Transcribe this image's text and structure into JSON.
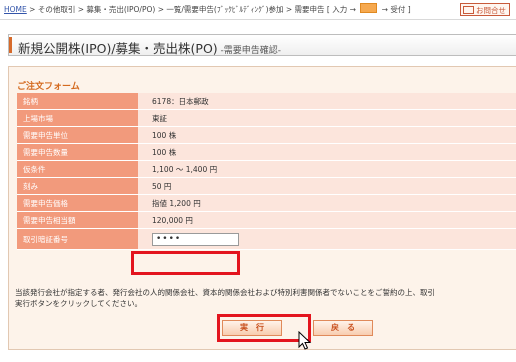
{
  "breadcrumb": {
    "home": "HOME",
    "path": " > その他取引 > 募集・売出(IPO/PO) > 一覧/需要申告(ﾌﾞｯｸﾋﾞﾙﾃﾞｨﾝｸﾞ)参加 > 需要申告 [ 入力 → ",
    "end": " → 受付 ]"
  },
  "contact": "お問合せ",
  "page_title": "新規公開株(IPO)/募集・売出株(PO)",
  "page_subtitle": " -需要申告確認-",
  "form": {
    "heading": "ご注文フォーム",
    "rows": [
      {
        "label": "銘柄",
        "value": "6178：日本郵政"
      },
      {
        "label": "上場市場",
        "value": "東証"
      },
      {
        "label": "需要申告単位",
        "value": "100 株"
      },
      {
        "label": "需要申告数量",
        "value": "100 株"
      },
      {
        "label": "仮条件",
        "value": "1,100 ～ 1,400 円"
      },
      {
        "label": "刻み",
        "value": "50 円"
      },
      {
        "label": "需要申告価格",
        "value": "指値 1,200 円"
      },
      {
        "label": "需要申告相当額",
        "value": "120,000 円"
      }
    ],
    "pin_label": "取引暗証番号",
    "pin_value": "••••"
  },
  "note_line1": "当該発行会社が指定する者、発行会社の人的関係会社、資本的関係会社および特別利害関係者でないことをご誓約の上、取引",
  "note_line2": "実行ボタンをクリックしてください。",
  "buttons": {
    "execute": "実　行",
    "back": "戻　る"
  },
  "colors": {
    "accent": "#d66a2a",
    "label_bg": "#f29a7c",
    "value_bg": "#fce5dc",
    "highlight": "#e3141e"
  }
}
